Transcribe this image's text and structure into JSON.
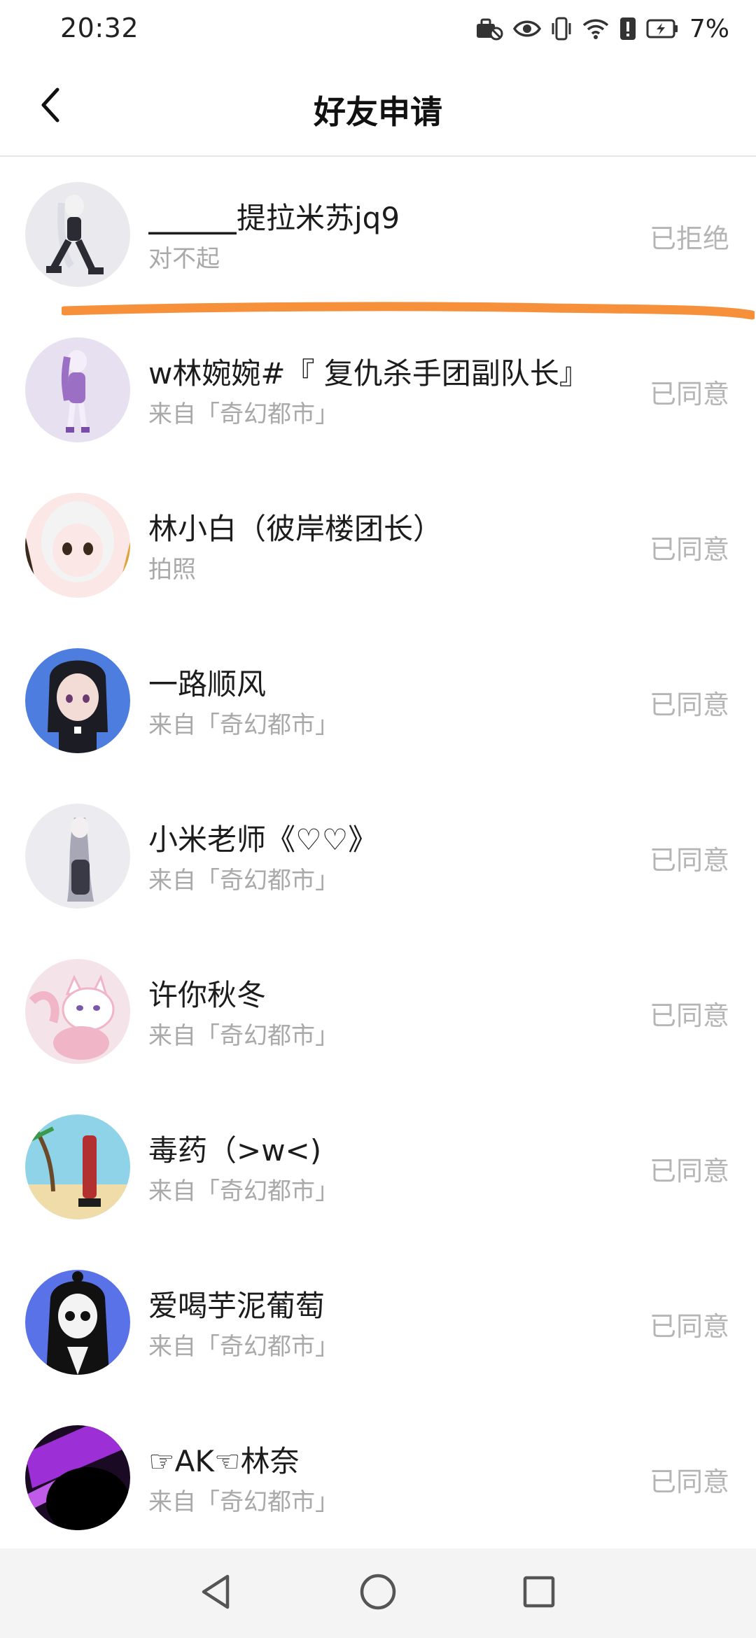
{
  "status_bar": {
    "time": "20:32",
    "battery_percent": "7%",
    "icons": [
      "briefcase-lock-icon",
      "eye-icon",
      "vibrate-icon",
      "wifi-icon",
      "alert-icon",
      "battery-charging-icon"
    ]
  },
  "header": {
    "title": "好友申请",
    "back_icon": "chevron-left-icon"
  },
  "requests": [
    {
      "name": "⎽⎽⎽提拉米苏jq9",
      "sub": "对不起",
      "status": "已拒绝",
      "avatar_colors": [
        "#e9e9ee",
        "#2b2b33",
        "#f2f2f2"
      ]
    },
    {
      "name": "w林婉婉#『 复仇杀手团副队长』",
      "sub": "来自「奇幻都市」",
      "status": "已同意",
      "avatar_colors": [
        "#e6e0f0",
        "#9a6fc4",
        "#f4eefa"
      ]
    },
    {
      "name": "林小白（彼岸楼团长）",
      "sub": "拍照",
      "status": "已同意",
      "avatar_colors": [
        "#fbe7e5",
        "#f3f3f3",
        "#3a2a1c"
      ]
    },
    {
      "name": "一路顺风",
      "sub": "来自「奇幻都市」",
      "status": "已同意",
      "avatar_colors": [
        "#4e7de0",
        "#1c1c24",
        "#f3dcd6"
      ]
    },
    {
      "name": "小米老师《♡♡》",
      "sub": "来自「奇幻都市」",
      "status": "已同意",
      "avatar_colors": [
        "#ececf0",
        "#a7a7b6",
        "#3a3a46"
      ]
    },
    {
      "name": "许你秋冬",
      "sub": "来自「奇幻都市」",
      "status": "已同意",
      "avatar_colors": [
        "#f5e3ea",
        "#f0b6c8",
        "#ffffff"
      ]
    },
    {
      "name": "毒药（>w<)",
      "sub": "来自「奇幻都市」",
      "status": "已同意",
      "avatar_colors": [
        "#8fd3e8",
        "#f0dca8",
        "#b33030"
      ]
    },
    {
      "name": "爱喝芋泥葡萄",
      "sub": "来自「奇幻都市」",
      "status": "已同意",
      "avatar_colors": [
        "#5a72e8",
        "#111111",
        "#f3f3f3"
      ]
    },
    {
      "name": "☞AK☜林奈",
      "sub": "来自「奇幻都市」",
      "status": "已同意",
      "avatar_colors": [
        "#1a0a24",
        "#9d2fd6",
        "#000000"
      ]
    }
  ],
  "annotation": {
    "color": "#f7903a"
  },
  "nav_bar": {
    "icons": [
      "nav-back-icon",
      "nav-home-icon",
      "nav-recents-icon"
    ]
  }
}
